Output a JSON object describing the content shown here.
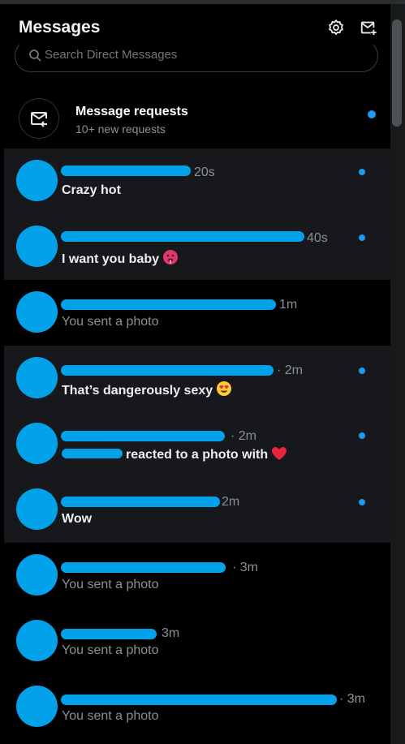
{
  "header": {
    "title": "Messages",
    "settings_icon": "gear-icon",
    "compose_icon": "new-message-icon"
  },
  "search": {
    "placeholder": "Search Direct Messages"
  },
  "requests": {
    "title": "Message requests",
    "subtitle": "10+ new requests"
  },
  "colors": {
    "accent": "#1d9bf0",
    "avatar": "#02a2ea",
    "unread_bg": "#16181c",
    "bg": "#000000"
  },
  "conversations": [
    {
      "time": "20s",
      "preview": "Crazy hot",
      "unread": true
    },
    {
      "time": "40s",
      "preview": "I want you baby",
      "unread": true,
      "emoji": "hot-face-emoji"
    },
    {
      "time": "1m",
      "preview": "You sent a photo",
      "unread": false
    },
    {
      "time": "· 2m",
      "preview": "That’s dangerously sexy",
      "unread": true,
      "emoji": "heart-eyes-emoji"
    },
    {
      "time": "· 2m",
      "preview": "reacted to a photo with",
      "unread": true,
      "emoji": "red-heart-emoji"
    },
    {
      "time": "2m",
      "preview": "Wow",
      "unread": true
    },
    {
      "time": "· 3m",
      "preview": "You sent a photo",
      "unread": false
    },
    {
      "time": "3m",
      "preview": "You sent a photo",
      "unread": false
    },
    {
      "time": "· 3m",
      "preview": "You sent a photo",
      "unread": false
    }
  ]
}
